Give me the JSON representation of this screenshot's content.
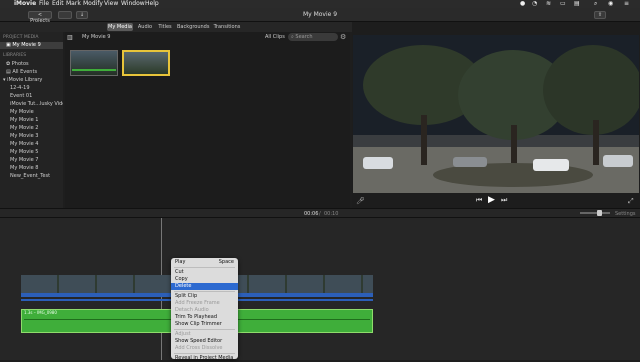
{
  "menubar": {
    "app": "iMovie",
    "items": [
      "File",
      "Edit",
      "Mark",
      "Modify",
      "View",
      "Window",
      "Help"
    ]
  },
  "toolbar": {
    "projects_label": "< Projects",
    "title": "My Movie 9"
  },
  "tabs": [
    {
      "label": "My Media",
      "active": true
    },
    {
      "label": "Audio",
      "active": false
    },
    {
      "label": "Titles",
      "active": false
    },
    {
      "label": "Backgrounds",
      "active": false
    },
    {
      "label": "Transitions",
      "active": false
    }
  ],
  "browser": {
    "heading": "My Movie 9",
    "filter": "All Clips",
    "search_placeholder": "Search"
  },
  "sidebar": {
    "project_media_header": "PROJECT MEDIA",
    "project_item": "My Movie 9",
    "libraries_header": "LIBRARIES",
    "top_items": [
      "Photos",
      "All Events"
    ],
    "library_name": "iMovie Library",
    "library_items": [
      "12-4-19",
      "Event 01",
      "iMovie Tut...lusky Video",
      "My Movie",
      "My Movie 1",
      "My Movie 2",
      "My Movie 3",
      "My Movie 4",
      "My Movie 5",
      "My Movie 7",
      "My Movie 8",
      "New_Event_Test"
    ]
  },
  "timeline": {
    "current_time": "00:06",
    "total_time": "00:10",
    "settings_label": "Settings",
    "clip_label": "1.3s – IMG_0980"
  },
  "context_menu": {
    "items": [
      {
        "label": "Play",
        "shortcut": "Space",
        "disabled": false,
        "highlight": false
      },
      {
        "sep": true
      },
      {
        "label": "Cut",
        "disabled": false,
        "highlight": false
      },
      {
        "label": "Copy",
        "disabled": false,
        "highlight": false
      },
      {
        "label": "Delete",
        "disabled": false,
        "highlight": true
      },
      {
        "sep": true
      },
      {
        "label": "Split Clip",
        "disabled": false,
        "highlight": false
      },
      {
        "label": "Add Freeze Frame",
        "disabled": true,
        "highlight": false
      },
      {
        "label": "Detach Audio",
        "disabled": true,
        "highlight": false
      },
      {
        "label": "Trim To Playhead",
        "disabled": false,
        "highlight": false
      },
      {
        "label": "Show Clip Trimmer",
        "disabled": false,
        "highlight": false
      },
      {
        "sep": true
      },
      {
        "label": "Adjust",
        "disabled": true,
        "highlight": false
      },
      {
        "label": "Show Speed Editor",
        "disabled": false,
        "highlight": false
      },
      {
        "label": "Add Cross Dissolve",
        "disabled": true,
        "highlight": false
      },
      {
        "sep": true
      },
      {
        "label": "Reveal in Project Media",
        "disabled": false,
        "highlight": false
      }
    ]
  },
  "colors": {
    "accent": "#2d6ad0",
    "audio_green": "#3fae3a",
    "clip_blue": "#2c5fb8"
  }
}
